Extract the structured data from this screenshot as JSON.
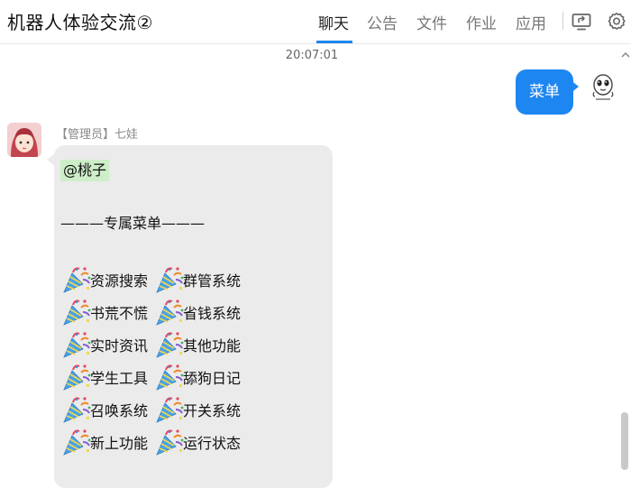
{
  "header": {
    "title": "机器人体验交流②",
    "tabs": [
      "聊天",
      "公告",
      "文件",
      "作业",
      "应用"
    ],
    "active_tab": "聊天",
    "accent_color": "#1e86f0",
    "icons": [
      "screen-share-icon",
      "gear-icon"
    ]
  },
  "chat": {
    "timestamp": "20:07:01",
    "my_message": {
      "text": "菜单",
      "bubble_color": "#1e86f0"
    },
    "incoming": {
      "sender": "【管理员】七娃",
      "mention": "@桃子",
      "heading": "———专属菜单———",
      "menu_items": [
        "资源搜索",
        "群管系统",
        "书荒不慌",
        "省钱系统",
        "实时资讯",
        "其他功能",
        "学生工具",
        "舔狗日记",
        "召唤系统",
        "开关系统",
        "新上功能",
        "运行状态"
      ],
      "item_icon": "party-popper-icon"
    }
  }
}
